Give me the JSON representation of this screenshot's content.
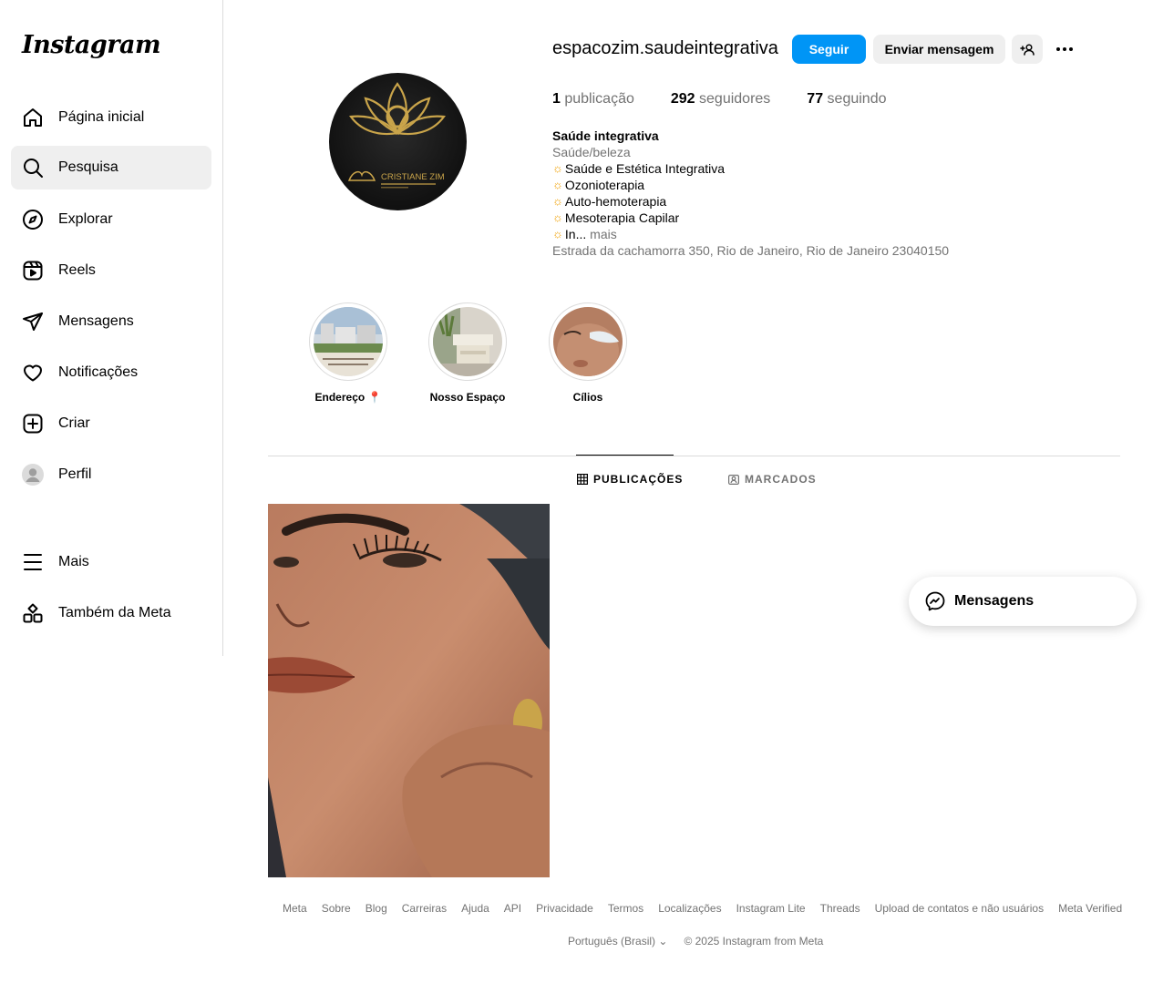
{
  "app": {
    "logo_text": "Instagram"
  },
  "sidebar": {
    "items": [
      {
        "label": "Página inicial",
        "icon": "home-icon"
      },
      {
        "label": "Pesquisa",
        "icon": "search-icon"
      },
      {
        "label": "Explorar",
        "icon": "compass-icon"
      },
      {
        "label": "Reels",
        "icon": "reels-icon"
      },
      {
        "label": "Mensagens",
        "icon": "send-icon"
      },
      {
        "label": "Notificações",
        "icon": "heart-icon"
      },
      {
        "label": "Criar",
        "icon": "plus-square-icon"
      },
      {
        "label": "Perfil",
        "icon": "avatar-icon"
      },
      {
        "label": "Mais",
        "icon": "menu-icon"
      },
      {
        "label": "Também da Meta",
        "icon": "meta-apps-icon"
      }
    ],
    "active": "Pesquisa"
  },
  "profile": {
    "username": "espacozim.saudeintegrativa",
    "follow_label": "Seguir",
    "message_label": "Enviar mensagem",
    "avatar_text": "CRISTIANE ZIM",
    "stats": {
      "posts_count": "1",
      "posts_label": "publicação",
      "followers_count": "292",
      "followers_label": "seguidores",
      "following_count": "77",
      "following_label": "seguindo"
    },
    "bio": {
      "name": "Saúde integrativa",
      "category": "Saúde/beleza",
      "lines": [
        "Saúde e Estética Integrativa",
        "Ozonioterapia",
        "Auto-hemoterapia",
        "Mesoterapia Capilar",
        "In..."
      ],
      "more_label": "mais",
      "address": "Estrada da cachamorra 350, Rio de Janeiro, Rio de Janeiro 23040150"
    }
  },
  "highlights": [
    {
      "label": "Endereço 📍"
    },
    {
      "label": "Nosso Espaço"
    },
    {
      "label": "Cílios"
    }
  ],
  "tabs": [
    {
      "label": "PUBLICAÇÕES",
      "active": true
    },
    {
      "label": "MARCADOS",
      "active": false
    }
  ],
  "floating_messages": {
    "label": "Mensagens"
  },
  "footer": {
    "links": [
      "Meta",
      "Sobre",
      "Blog",
      "Carreiras",
      "Ajuda",
      "API",
      "Privacidade",
      "Termos",
      "Localizações",
      "Instagram Lite",
      "Threads",
      "Upload de contatos e não usuários",
      "Meta Verified"
    ],
    "language": "Português (Brasil)",
    "copyright": "© 2025 Instagram from Meta"
  },
  "colors": {
    "accent": "#0095f6",
    "muted": "#737373",
    "border": "#dbdbdb",
    "button_bg": "#efefef",
    "gold": "#c9a44a"
  }
}
